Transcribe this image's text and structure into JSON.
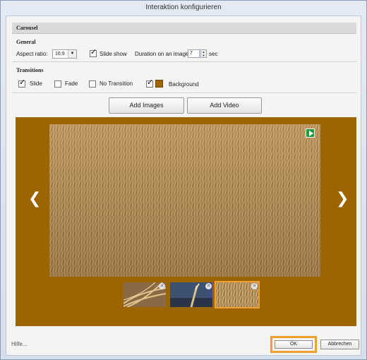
{
  "window": {
    "title": "Interaktion konfigurieren"
  },
  "carousel": {
    "section_title": "Carousel",
    "general": {
      "heading": "General",
      "aspect_ratio_label": "Aspect ratio:",
      "aspect_ratio_value": "16:9",
      "slideshow_label": "Slide show",
      "slideshow_checked": true,
      "duration_label": "Duration on an image",
      "duration_value": "7",
      "duration_unit": "sec"
    },
    "transitions": {
      "heading": "Transitions",
      "options": [
        {
          "label": "Slide",
          "checked": true
        },
        {
          "label": "Fade",
          "checked": false
        },
        {
          "label": "No Transition",
          "checked": false
        }
      ],
      "background_label": "Background",
      "background_checked": true,
      "background_color": "#a16600"
    },
    "buttons": {
      "add_images": "Add Images",
      "add_video": "Add Video"
    },
    "stage": {
      "background_color": "#9c6500",
      "thumbnails": [
        {
          "name": "wheat-closeup",
          "selected": false
        },
        {
          "name": "wheat-stalk-blue-sky",
          "selected": false
        },
        {
          "name": "wheat-field",
          "selected": true
        }
      ]
    }
  },
  "footer": {
    "help": "Hilfe...",
    "ok": "OK",
    "cancel": "Abbrechen"
  }
}
